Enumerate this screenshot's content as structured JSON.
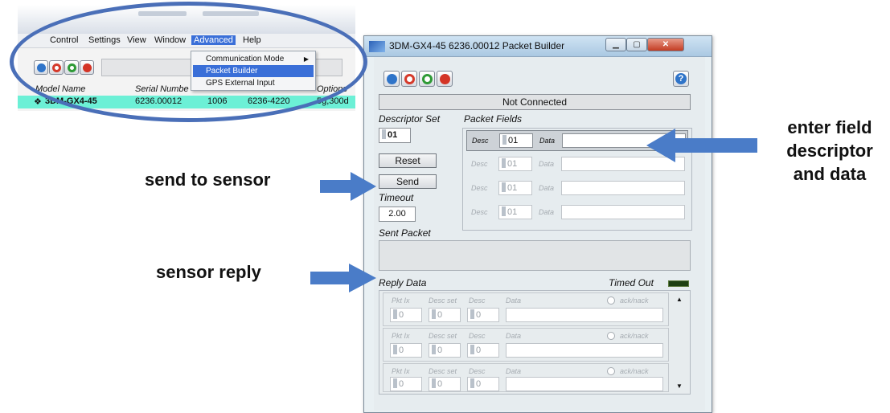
{
  "main_window": {
    "menu": [
      "Control",
      "Settings",
      "View",
      "Window",
      "Advanced",
      "Help"
    ],
    "advanced_menu": [
      {
        "label": "Communication Mode",
        "submenu": true
      },
      {
        "label": "Packet Builder",
        "selected": true
      },
      {
        "label": "GPS External Input"
      }
    ],
    "columns": [
      "Model Name",
      "Serial Numbe",
      "Options"
    ],
    "device_row": {
      "model": "3DM-GX4-45",
      "serial": "6236.00012",
      "col3": "1006",
      "col4": "6236-4220",
      "options": "5g,300d"
    },
    "highlight_color": "#6cf0d6"
  },
  "packet_builder": {
    "title": "3DM-GX4-45 6236.00012 Packet Builder",
    "window_buttons": [
      "minimize",
      "maximize",
      "close"
    ],
    "status": "Not Connected",
    "descriptor_set_label": "Descriptor Set",
    "descriptor_set_value": "01",
    "packet_fields_label": "Packet Fields",
    "packet_fields": [
      {
        "desc_label": "Desc",
        "desc": "01",
        "data_label": "Data",
        "data": "",
        "enabled": true
      },
      {
        "desc_label": "Desc",
        "desc": "01",
        "data_label": "Data",
        "data": "",
        "enabled": false
      },
      {
        "desc_label": "Desc",
        "desc": "01",
        "data_label": "Data",
        "data": "",
        "enabled": false
      },
      {
        "desc_label": "Desc",
        "desc": "01",
        "data_label": "Data",
        "data": "",
        "enabled": false
      }
    ],
    "reset_label": "Reset",
    "send_label": "Send",
    "timeout_label": "Timeout",
    "timeout_value": "2.00",
    "sent_packet_label": "Sent Packet",
    "reply_data_label": "Reply Data",
    "timed_out_label": "Timed Out",
    "reply_rows": [
      {
        "pkt_label": "Pkt Ix",
        "descset_label": "Desc set",
        "desc_label": "Desc",
        "data_label": "Data",
        "ack_label": "ack/nack",
        "pkt": "0",
        "descset": "0",
        "desc": "0"
      },
      {
        "pkt_label": "Pkt Ix",
        "descset_label": "Desc set",
        "desc_label": "Desc",
        "data_label": "Data",
        "ack_label": "ack/nack",
        "pkt": "0",
        "descset": "0",
        "desc": "0"
      },
      {
        "pkt_label": "Pkt Ix",
        "descset_label": "Desc set",
        "desc_label": "Desc",
        "data_label": "Data",
        "ack_label": "ack/nack",
        "pkt": "0",
        "descset": "0",
        "desc": "0"
      }
    ],
    "help_label": "?"
  },
  "annotations": {
    "enter_field": [
      "enter  field",
      "descriptor",
      "and data"
    ],
    "send_to_sensor": "send to sensor",
    "sensor_reply": "sensor reply"
  },
  "colors": {
    "arrow": "#4a7cc8",
    "ellipse": "#4a6fb8",
    "selection": "#3a6fd8"
  }
}
